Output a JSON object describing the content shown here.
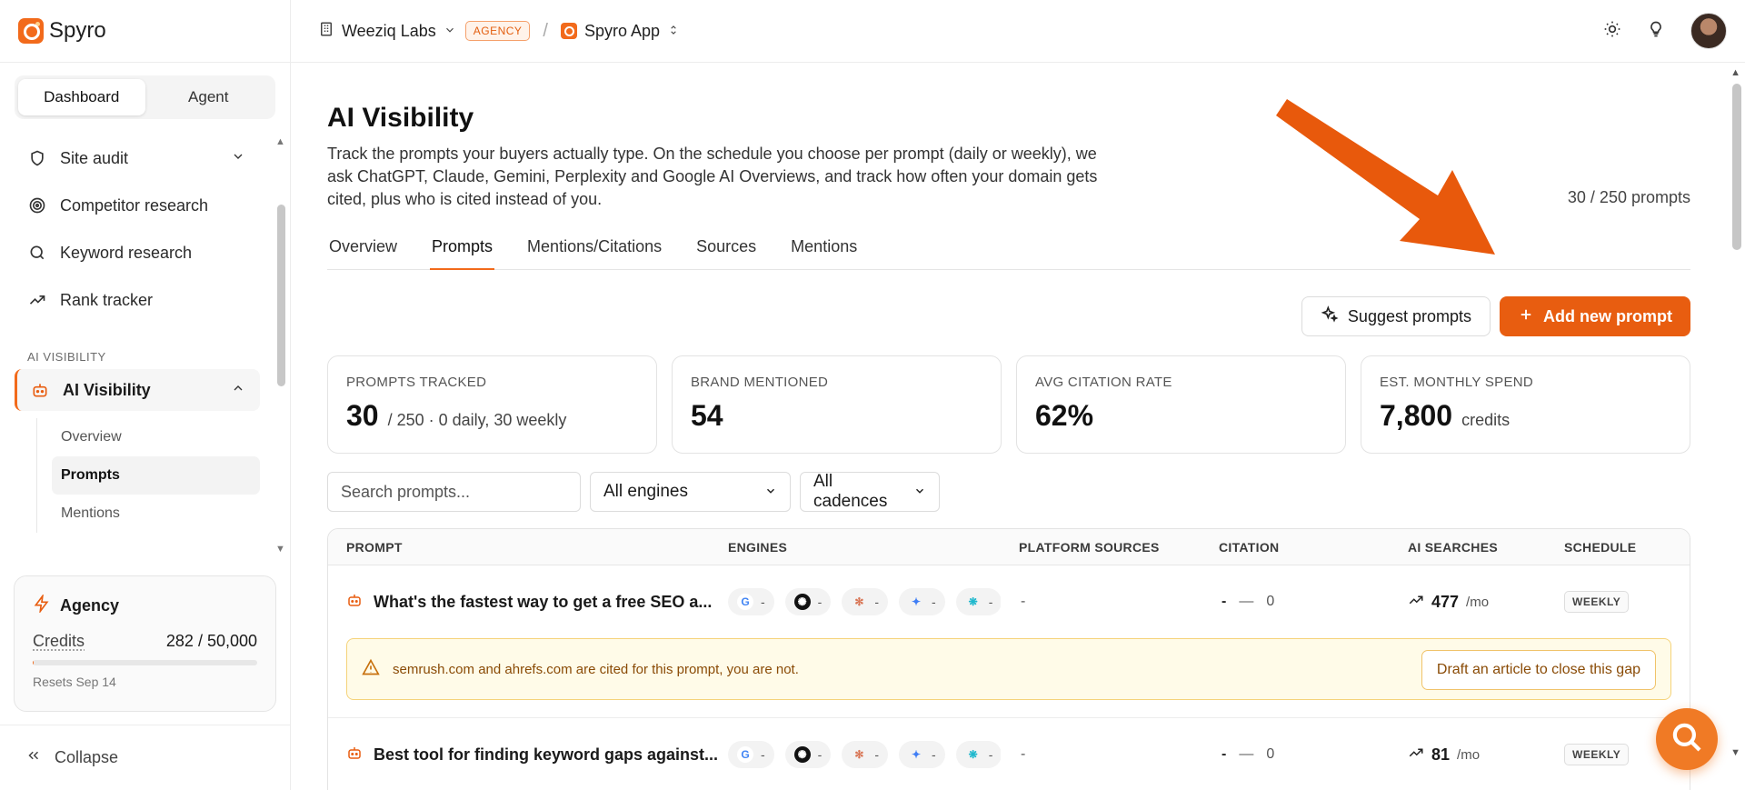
{
  "brand": {
    "name": "Spyro"
  },
  "sidebar": {
    "modes": [
      {
        "label": "Dashboard",
        "active": true
      },
      {
        "label": "Agent",
        "active": false
      }
    ],
    "items": [
      {
        "label": "Site audit",
        "icon": "shield-icon",
        "expandable": true
      },
      {
        "label": "Competitor research",
        "icon": "target-icon"
      },
      {
        "label": "Keyword research",
        "icon": "search-icon"
      },
      {
        "label": "Rank tracker",
        "icon": "trending-up-icon"
      }
    ],
    "section_label": "AI VISIBILITY",
    "active_item": {
      "label": "AI Visibility",
      "icon": "robot-icon"
    },
    "sub_items": [
      {
        "label": "Overview",
        "active": false
      },
      {
        "label": "Prompts",
        "active": true
      },
      {
        "label": "Mentions",
        "active": false
      }
    ],
    "agency": {
      "title": "Agency",
      "credits_label": "Credits",
      "credits_value": "282 / 50,000",
      "credits_used_fraction": 0.0056,
      "resets": "Resets Sep 14"
    },
    "collapse_label": "Collapse"
  },
  "topbar": {
    "workspace": "Weeziq Labs",
    "workspace_badge": "AGENCY",
    "app": "Spyro App"
  },
  "page": {
    "title": "AI Visibility",
    "description": "Track the prompts your buyers actually type. On the schedule you choose per prompt (daily or weekly), we ask ChatGPT, Claude, Gemini, Perplexity and Google AI Overviews, and track how often your domain gets cited, plus who is cited instead of you.",
    "prompt_count": "30 / 250 prompts",
    "tabs": [
      {
        "label": "Overview",
        "active": false
      },
      {
        "label": "Prompts",
        "active": true
      },
      {
        "label": "Mentions/Citations",
        "active": false
      },
      {
        "label": "Sources",
        "active": false
      },
      {
        "label": "Mentions",
        "active": false
      }
    ],
    "suggest_label": "Suggest prompts",
    "add_label": "Add new prompt",
    "stats": [
      {
        "label": "PROMPTS TRACKED",
        "value": "30",
        "sub": "/ 250 · 0 daily, 30 weekly"
      },
      {
        "label": "BRAND MENTIONED",
        "value": "54",
        "sub": ""
      },
      {
        "label": "AVG CITATION RATE",
        "value": "62%",
        "sub": ""
      },
      {
        "label": "EST. MONTHLY SPEND",
        "value": "7,800",
        "sub": "credits"
      }
    ],
    "search_placeholder": "Search prompts...",
    "engine_filter": "All engines",
    "cadence_filter": "All cadences",
    "columns": [
      "PROMPT",
      "ENGINES",
      "PLATFORM SOURCES",
      "CITATION",
      "AI SEARCHES",
      "SCHEDULE"
    ],
    "rows": [
      {
        "prompt": "What's the fastest way to get a free SEO a...",
        "platform_sources": "-",
        "citation_dash": "-",
        "citation_count": "0",
        "searches": "477",
        "per": "/mo",
        "schedule": "WEEKLY",
        "alert": "semrush.com and ahrefs.com are cited for this prompt, you are not.",
        "alert_action": "Draft an article to close this gap"
      },
      {
        "prompt": "Best tool for finding keyword gaps against...",
        "platform_sources": "-",
        "citation_dash": "-",
        "citation_count": "0",
        "searches": "81",
        "per": "/mo",
        "schedule": "WEEKLY"
      }
    ],
    "engine_value": "-"
  },
  "colors": {
    "accent": "#e85d10",
    "alert_bg": "#fffbe8",
    "alert_text": "#8a4b06"
  }
}
